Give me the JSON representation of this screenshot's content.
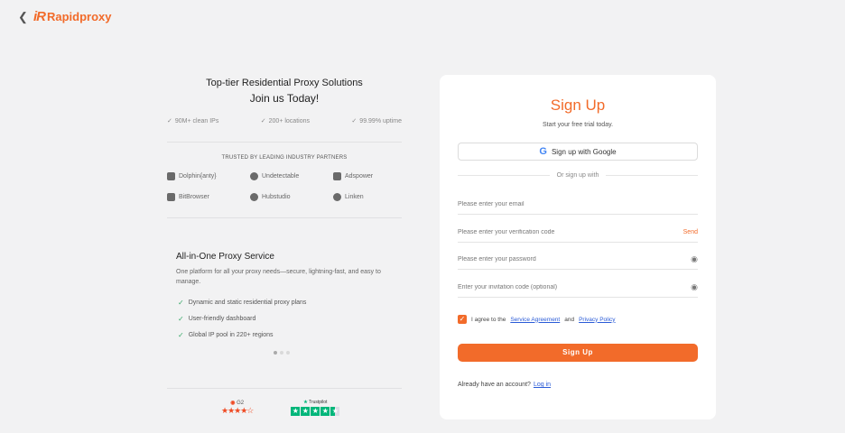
{
  "header": {
    "back_icon": "chevron-left-icon",
    "logo_mark": "iR",
    "logo_text": "Rapidproxy"
  },
  "left": {
    "headline1": "Top-tier Residential Proxy Solutions",
    "headline2": "Join us Today!",
    "features": [
      "90M+ clean IPs",
      "200+ locations",
      "99.99% uptime"
    ],
    "trusted_title": "TRUSTED BY LEADING INDUSTRY PARTNERS",
    "partners": [
      "Dolphin{anty}",
      "Undetectable",
      "Adspower",
      "BitBrowser",
      "Hubstudio",
      "Linken"
    ],
    "service_title": "All-in-One Proxy Service",
    "service_desc": "One platform for all your proxy needs—secure, lightning-fast, and easy to manage.",
    "bullets": [
      "Dynamic and static residential proxy plans",
      "User-friendly dashboard",
      "Global IP pool in 220+ regions"
    ],
    "carousel": {
      "count": 3,
      "active": 1
    },
    "ratings": {
      "g2_label": "G2",
      "g2_stars": 4.5,
      "trustpilot_label": "Trustpilot",
      "trustpilot_stars": 4.5
    }
  },
  "form": {
    "title": "Sign Up",
    "subtitle": "Start your free trial today.",
    "google_label": "Sign up with Google",
    "divider": "Or sign up with",
    "email_placeholder": "Please enter your email",
    "code_placeholder": "Please enter your verification code",
    "send_label": "Send",
    "password_placeholder": "Please enter your password",
    "invite_placeholder": "Enter your invitation code (optional)",
    "agree_prefix": "I agree to the",
    "service_agreement": "Service Agreement",
    "and": "and",
    "privacy_policy": "Privacy Policy",
    "agree_checked": true,
    "submit_label": "Sign Up",
    "have_account": "Already have an account?",
    "login_label": "Log in"
  },
  "colors": {
    "accent": "#f26b2a",
    "link": "#2a5bd7",
    "check": "#3aaa6a",
    "trustpilot": "#00b67a",
    "g2": "#ef4a23"
  }
}
